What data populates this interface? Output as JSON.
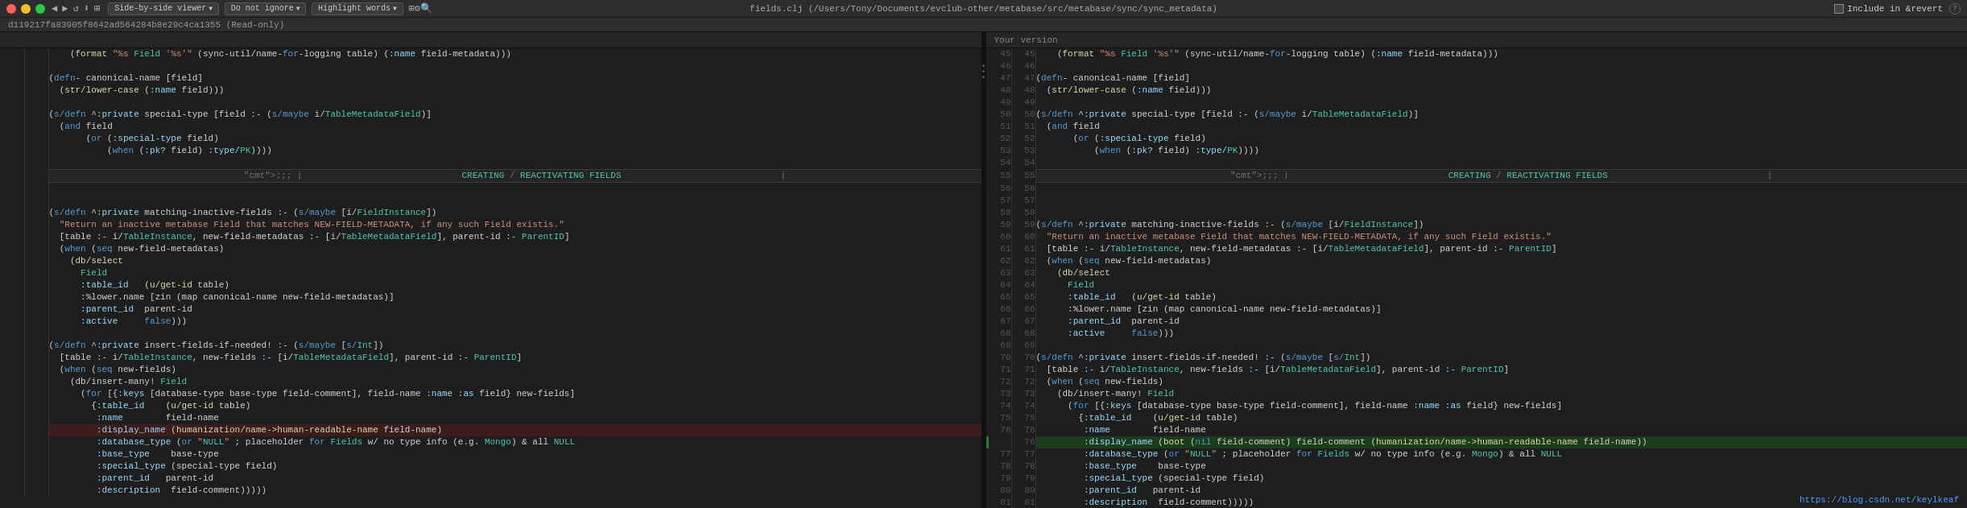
{
  "titlebar": {
    "title": "fields.clj (/Users/Tony/Documents/evclub-other/metabase/src/metabase/sync/sync_metadata)",
    "traffic_lights": [
      "close",
      "minimize",
      "maximize"
    ],
    "toolbar_buttons": [
      {
        "label": "Side-by-side viewer",
        "id": "view-mode"
      },
      {
        "label": "Do not ignore",
        "id": "ignore-mode"
      },
      {
        "label": "Highlight words",
        "id": "highlight-mode"
      }
    ],
    "icons": [
      "back",
      "forward",
      "refresh",
      "save",
      "sidebyside",
      "settings",
      "search"
    ],
    "include_revert": "Include in &revert",
    "help": "?"
  },
  "infobar": {
    "text": "d119217fa83905f8642ad564284b8e29c4ca1355 (Read-only)"
  },
  "left_pane": {
    "header": ""
  },
  "right_pane": {
    "header": "Your version"
  },
  "url": "https://blog.csdn.net/keylkeaf",
  "left_lines": [
    {
      "num": "",
      "code": "    (format \"%s Field '%s'\" (sync-util/name-for-logging table) (:name field-metadata)))",
      "class": ""
    },
    {
      "num": "",
      "code": "",
      "class": ""
    },
    {
      "num": "",
      "code": "(defn- canonical-name [field]",
      "class": ""
    },
    {
      "num": "",
      "code": "  (str/lower-case (:name field)))",
      "class": ""
    },
    {
      "num": "",
      "code": "",
      "class": ""
    },
    {
      "num": "",
      "code": "(s/defn ^:private special-type [field :- (s/maybe i/TableMetadataField)]",
      "class": ""
    },
    {
      "num": "",
      "code": "  (and field",
      "class": ""
    },
    {
      "num": "",
      "code": "       (or (:special-type field)",
      "class": ""
    },
    {
      "num": "",
      "code": "           (when (:pk? field) :type/PK))))",
      "class": ""
    },
    {
      "num": "",
      "code": "",
      "class": ""
    },
    {
      "num": "",
      "code": ";;; |                                   CREATING / REACTIVATING FIELDS                                   |",
      "class": "line-divider-content"
    },
    {
      "num": "",
      "code": "",
      "class": ""
    },
    {
      "num": "",
      "code": "(s/defn ^:private matching-inactive-fields :- (s/maybe [i/FieldInstance])",
      "class": ""
    },
    {
      "num": "",
      "code": "  \"Return an inactive metabase Field that matches NEW-FIELD-METADATA, if any such Field existis.\"",
      "class": "str-line"
    },
    {
      "num": "",
      "code": "  [table :- i/TableInstance, new-field-metadatas :- [i/TableMetadataField], parent-id :- ParentID]",
      "class": ""
    },
    {
      "num": "",
      "code": "  (when (seq new-field-metadatas)",
      "class": ""
    },
    {
      "num": "",
      "code": "    (db/select",
      "class": ""
    },
    {
      "num": "",
      "code": "      Field",
      "class": ""
    },
    {
      "num": "",
      "code": "      :table_id   (u/get-id table)",
      "class": ""
    },
    {
      "num": "",
      "code": "      :%lower.name [zin (map canonical-name new-field-metadatas)]",
      "class": ""
    },
    {
      "num": "",
      "code": "      :parent_id  parent-id",
      "class": ""
    },
    {
      "num": "",
      "code": "      :active     false)))",
      "class": ""
    },
    {
      "num": "",
      "code": "",
      "class": ""
    },
    {
      "num": "",
      "code": "(s/defn ^:private insert-fields-if-needed! :- (s/maybe [s/Int])",
      "class": ""
    },
    {
      "num": "",
      "code": "  [table :- i/TableInstance, new-fields :- [i/TableMetadataField], parent-id :- ParentID]",
      "class": ""
    },
    {
      "num": "",
      "code": "  (when (seq new-fields)",
      "class": ""
    },
    {
      "num": "",
      "code": "    (db/insert-many! Field",
      "class": ""
    },
    {
      "num": "",
      "code": "      (for [{:keys [database-type base-type field-comment], field-name :name :as field} new-fields]",
      "class": ""
    },
    {
      "num": "",
      "code": "        {:table_id    (u/get-id table)",
      "class": ""
    },
    {
      "num": "",
      "code": "         :name        field-name",
      "class": ""
    },
    {
      "num": "",
      "code": "         :display_name (humanization/name->human-readable-name field-name)",
      "class": "line-removed"
    },
    {
      "num": "",
      "code": "         :database_type (or \"NULL\" ; placeholder for Fields w/ no type info (e.g. Mongo) & all NULL",
      "class": ""
    },
    {
      "num": "",
      "code": "         :base_type    base-type",
      "class": ""
    },
    {
      "num": "",
      "code": "         :special_type (special-type field)",
      "class": ""
    },
    {
      "num": "",
      "code": "         :parent_id   parent-id",
      "class": ""
    },
    {
      "num": "",
      "code": "         :description  field-comment))))}",
      "class": ""
    }
  ],
  "right_lines": [
    {
      "num": "45",
      "lnum": "45",
      "code": "    (format \"%s Field '%s'\" (sync-util/name-for-logging table) (:name field-metadata)))",
      "class": ""
    },
    {
      "num": "46",
      "lnum": "46",
      "code": "",
      "class": ""
    },
    {
      "num": "47",
      "lnum": "47",
      "code": "(defn- canonical-name [field]",
      "class": ""
    },
    {
      "num": "48",
      "lnum": "48",
      "code": "  (str/lower-case (:name field)))",
      "class": ""
    },
    {
      "num": "49",
      "lnum": "49",
      "code": "",
      "class": ""
    },
    {
      "num": "50",
      "lnum": "50",
      "code": "(s/defn ^:private special-type [field :- (s/maybe i/TableMetadataField)]",
      "class": ""
    },
    {
      "num": "51",
      "lnum": "51",
      "code": "  (and field",
      "class": ""
    },
    {
      "num": "52",
      "lnum": "52",
      "code": "       (or (:special-type field)",
      "class": ""
    },
    {
      "num": "53",
      "lnum": "53",
      "code": "           (when (:pk? field) :type/PK))))",
      "class": ""
    },
    {
      "num": "54",
      "lnum": "54",
      "code": "",
      "class": ""
    },
    {
      "num": "55",
      "lnum": "55",
      "code": ";;; |                                   CREATING / REACTIVATING FIELDS                                   |",
      "class": "line-divider-content"
    },
    {
      "num": "56",
      "lnum": "56",
      "code": "",
      "class": ""
    },
    {
      "num": "57",
      "lnum": "57",
      "code": "",
      "class": ""
    },
    {
      "num": "58",
      "lnum": "58",
      "code": "",
      "class": ""
    },
    {
      "num": "59",
      "lnum": "59",
      "code": "(s/defn ^:private matching-inactive-fields :- (s/maybe [i/FieldInstance])",
      "class": ""
    },
    {
      "num": "60",
      "lnum": "60",
      "code": "  \"Return an inactive metabase Field that matches NEW-FIELD-METADATA, if any such Field existis.\"",
      "class": "str-line"
    },
    {
      "num": "61",
      "lnum": "61",
      "code": "  [table :- i/TableInstance, new-field-metadatas :- [i/TableMetadataField], parent-id :- ParentID]",
      "class": ""
    },
    {
      "num": "62",
      "lnum": "62",
      "code": "  (when (seq new-field-metadatas)",
      "class": ""
    },
    {
      "num": "63",
      "lnum": "63",
      "code": "    (db/select",
      "class": ""
    },
    {
      "num": "64",
      "lnum": "64",
      "code": "      Field",
      "class": ""
    },
    {
      "num": "65",
      "lnum": "65",
      "code": "      :table_id   (u/get-id table)",
      "class": ""
    },
    {
      "num": "66",
      "lnum": "66",
      "code": "      :%lower.name [zin (map canonical-name new-field-metadatas)]",
      "class": ""
    },
    {
      "num": "67",
      "lnum": "67",
      "code": "      :parent_id  parent-id",
      "class": ""
    },
    {
      "num": "68",
      "lnum": "68",
      "code": "      :active     false)))",
      "class": ""
    },
    {
      "num": "69",
      "lnum": "69",
      "code": "",
      "class": ""
    },
    {
      "num": "70",
      "lnum": "70",
      "code": "(s/defn ^:private insert-fields-if-needed! :- (s/maybe [s/Int])",
      "class": ""
    },
    {
      "num": "71",
      "lnum": "71",
      "code": "  [table :- i/TableInstance, new-fields :- [i/TableMetadataField], parent-id :- ParentID]",
      "class": ""
    },
    {
      "num": "72",
      "lnum": "72",
      "code": "  (when (seq new-fields)",
      "class": ""
    },
    {
      "num": "73",
      "lnum": "73",
      "code": "    (db/insert-many! Field",
      "class": ""
    },
    {
      "num": "74",
      "lnum": "74",
      "code": "      (for [{:keys [database-type base-type field-comment], field-name :name :as field} new-fields]",
      "class": ""
    },
    {
      "num": "75",
      "lnum": "75",
      "code": "        {:table_id    (u/get-id table)",
      "class": ""
    },
    {
      "num": "76",
      "lnum": "76",
      "code": "         :name        field-name",
      "class": ""
    },
    {
      "num": "76",
      "lnum": "76b",
      "code": "         :display_name (boot (nil field-comment) field-comment (humanization/name->human-readable-name field-name))",
      "class": "line-added"
    },
    {
      "num": "77",
      "lnum": "77",
      "code": "         :database_type (or \"NULL\" ; placeholder for Fields w/ no type info (e.g. Mongo) & all NULL",
      "class": ""
    },
    {
      "num": "78",
      "lnum": "78",
      "code": "         :base_type    base-type",
      "class": ""
    },
    {
      "num": "79",
      "lnum": "79",
      "code": "         :special_type (special-type field)",
      "class": ""
    },
    {
      "num": "80",
      "lnum": "80",
      "code": "         :parent_id   parent-id",
      "class": ""
    },
    {
      "num": "81",
      "lnum": "81",
      "code": "         :description  field-comment))))}",
      "class": ""
    }
  ]
}
